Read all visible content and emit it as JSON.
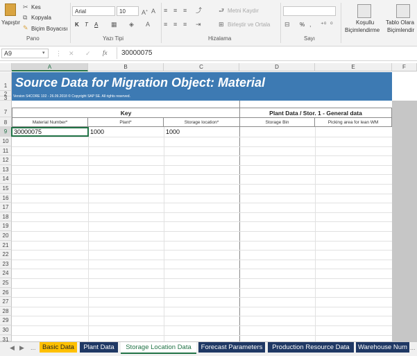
{
  "ribbon": {
    "clipboard": {
      "paste_label": "Yapıştır",
      "cut_label": "Kes",
      "copy_label": "Kopyala",
      "format_painter_label": "Biçim Boyacısı",
      "group_label": "Pano"
    },
    "font": {
      "font_name": "Arial",
      "font_size": "10",
      "bold": "K",
      "italic": "T",
      "underline": "A",
      "group_label": "Yazı Tipi"
    },
    "alignment": {
      "wrap_text_label": "Metni Kaydır",
      "merge_label": "Birleştir ve Ortala",
      "group_label": "Hizalama"
    },
    "number": {
      "percent": "%",
      "group_label": "Sayı"
    },
    "styles": {
      "conditional_line1": "Koşullu",
      "conditional_line2": "Biçimlendirme",
      "table_line1": "Tablo Olara",
      "table_line2": "Biçimlendir"
    }
  },
  "formula_bar": {
    "cell_ref": "A9",
    "fx": "fx",
    "value": "30000075"
  },
  "columns": [
    "A",
    "B",
    "C",
    "D",
    "E",
    "F"
  ],
  "rows": [
    "1",
    "2",
    "3",
    "7",
    "8",
    "9",
    "10",
    "11",
    "12",
    "13",
    "14",
    "15",
    "16",
    "17",
    "18",
    "19",
    "20",
    "21",
    "22",
    "23",
    "24",
    "25",
    "26",
    "27",
    "28",
    "29",
    "30",
    "31"
  ],
  "sheet": {
    "title": "Source Data for Migration Object:  Material",
    "version": "Version S4CORE 102  - 26.09.2018 © Copyright SAP SE. All rights reserved.",
    "sections": [
      {
        "label": "Key"
      },
      {
        "label": "Plant Data / Stor. 1 - General data"
      }
    ],
    "field_headers": [
      "Material Number*",
      "Plant*",
      "Storage location*",
      "Storage Bin",
      "Picking area for lean WM"
    ],
    "data_row": [
      "30000075",
      "1000",
      "1000",
      "",
      ""
    ]
  },
  "tabs": [
    {
      "label": "Basic Data",
      "color": "#ffc000",
      "text_color": "#222222"
    },
    {
      "label": "Plant Data",
      "color": "#1f3864",
      "text_color": "#ffffff"
    },
    {
      "label": "Storage Location Data",
      "color": "#ffffff",
      "text_color": "#217346",
      "active": true
    },
    {
      "label": "Forecast Parameters",
      "color": "#1f3864",
      "text_color": "#ffffff"
    },
    {
      "label": "Production Resource Data",
      "color": "#1f3864",
      "text_color": "#ffffff"
    },
    {
      "label": "Warehouse Num",
      "color": "#1f3864",
      "text_color": "#ffffff"
    }
  ],
  "tab_nav": {
    "more": "...",
    "more_right": "..."
  }
}
